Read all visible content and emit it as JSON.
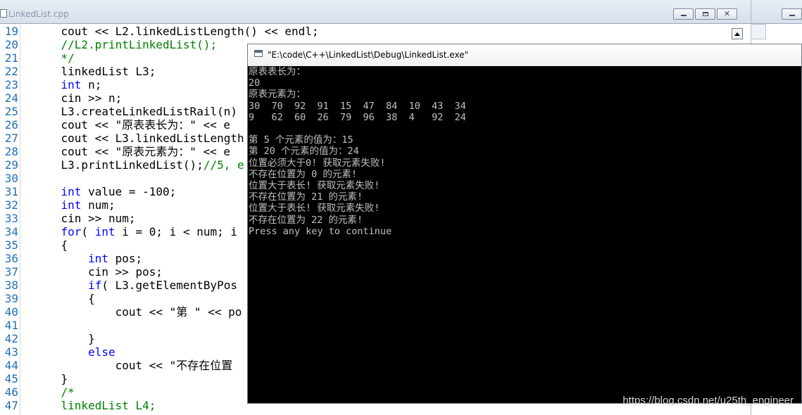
{
  "editor": {
    "title": "LinkedList.cpp",
    "lines": [
      {
        "n": "19",
        "segs": [
          {
            "t": "    cout << L2.linkedListLength() << endl;",
            "c": ""
          }
        ]
      },
      {
        "n": "20",
        "segs": [
          {
            "t": "    //L2.printLinkedList();",
            "c": "cm"
          }
        ]
      },
      {
        "n": "21",
        "segs": [
          {
            "t": "    */",
            "c": "cm"
          }
        ]
      },
      {
        "n": "22",
        "segs": [
          {
            "t": "    linkedList L3;",
            "c": ""
          }
        ]
      },
      {
        "n": "23",
        "segs": [
          {
            "t": "    ",
            "c": ""
          },
          {
            "t": "int",
            "c": "kw"
          },
          {
            "t": " n;",
            "c": ""
          }
        ]
      },
      {
        "n": "24",
        "segs": [
          {
            "t": "    cin >> n;",
            "c": ""
          }
        ]
      },
      {
        "n": "25",
        "segs": [
          {
            "t": "    L3.createLinkedListRail(n)",
            "c": ""
          }
        ]
      },
      {
        "n": "26",
        "segs": [
          {
            "t": "    cout << \"原表表长为：\" << e",
            "c": ""
          }
        ]
      },
      {
        "n": "27",
        "segs": [
          {
            "t": "    cout << L3.linkedListLength",
            "c": ""
          }
        ]
      },
      {
        "n": "28",
        "segs": [
          {
            "t": "    cout << \"原表元素为：\" << e",
            "c": ""
          }
        ]
      },
      {
        "n": "29",
        "segs": [
          {
            "t": "    L3.printLinkedList();",
            "c": ""
          },
          {
            "t": "//5, e",
            "c": "cm"
          }
        ]
      },
      {
        "n": "30",
        "segs": [
          {
            "t": "",
            "c": ""
          }
        ]
      },
      {
        "n": "31",
        "segs": [
          {
            "t": "    ",
            "c": ""
          },
          {
            "t": "int",
            "c": "kw"
          },
          {
            "t": " value = -100;",
            "c": ""
          }
        ]
      },
      {
        "n": "32",
        "segs": [
          {
            "t": "    ",
            "c": ""
          },
          {
            "t": "int",
            "c": "kw"
          },
          {
            "t": " num;",
            "c": ""
          }
        ]
      },
      {
        "n": "33",
        "segs": [
          {
            "t": "    cin >> num;",
            "c": ""
          }
        ]
      },
      {
        "n": "34",
        "segs": [
          {
            "t": "    ",
            "c": ""
          },
          {
            "t": "for",
            "c": "kw"
          },
          {
            "t": "( ",
            "c": ""
          },
          {
            "t": "int",
            "c": "kw"
          },
          {
            "t": " i = 0; i < num; i",
            "c": ""
          }
        ]
      },
      {
        "n": "35",
        "segs": [
          {
            "t": "    {",
            "c": ""
          }
        ]
      },
      {
        "n": "36",
        "segs": [
          {
            "t": "        ",
            "c": ""
          },
          {
            "t": "int",
            "c": "kw"
          },
          {
            "t": " pos;",
            "c": ""
          }
        ]
      },
      {
        "n": "37",
        "segs": [
          {
            "t": "        cin >> pos;",
            "c": ""
          }
        ]
      },
      {
        "n": "38",
        "segs": [
          {
            "t": "        ",
            "c": ""
          },
          {
            "t": "if",
            "c": "kw"
          },
          {
            "t": "( L3.getElementByPos",
            "c": ""
          }
        ]
      },
      {
        "n": "39",
        "segs": [
          {
            "t": "        {",
            "c": ""
          }
        ]
      },
      {
        "n": "40",
        "segs": [
          {
            "t": "            cout << \"第 \" << po",
            "c": ""
          }
        ]
      },
      {
        "n": "41",
        "segs": [
          {
            "t": "",
            "c": ""
          }
        ]
      },
      {
        "n": "42",
        "segs": [
          {
            "t": "        }",
            "c": ""
          }
        ]
      },
      {
        "n": "43",
        "segs": [
          {
            "t": "        ",
            "c": ""
          },
          {
            "t": "else",
            "c": "kw"
          }
        ]
      },
      {
        "n": "44",
        "segs": [
          {
            "t": "            cout << \"不存在位置",
            "c": ""
          }
        ]
      },
      {
        "n": "45",
        "segs": [
          {
            "t": "    }",
            "c": ""
          }
        ]
      },
      {
        "n": "46",
        "segs": [
          {
            "t": "    /*",
            "c": "cm"
          }
        ]
      },
      {
        "n": "47",
        "segs": [
          {
            "t": "    linkedList L4;",
            "c": "cm"
          }
        ]
      }
    ]
  },
  "console": {
    "title": "\"E:\\code\\C++\\LinkedList\\Debug\\LinkedList.exe\"",
    "lines": [
      "原表表长为：",
      "20",
      "原表元素为：",
      "30  70  92  91  15  47  84  10  43  34",
      "9   62  60  26  79  96  38  4   92  24",
      "",
      "第 5 个元素的值为：15",
      "第 20 个元素的值为：24",
      "位置必须大于0! 获取元素失败!",
      "不存在位置为 0 的元素!",
      "位置大于表长! 获取元素失败!",
      "不存在位置为 21 的元素!",
      "位置大于表长! 获取元素失败!",
      "不存在位置为 22 的元素!",
      "Press any key to continue"
    ]
  },
  "watermark": "https://blog.csdn.net/u25th_engineer"
}
